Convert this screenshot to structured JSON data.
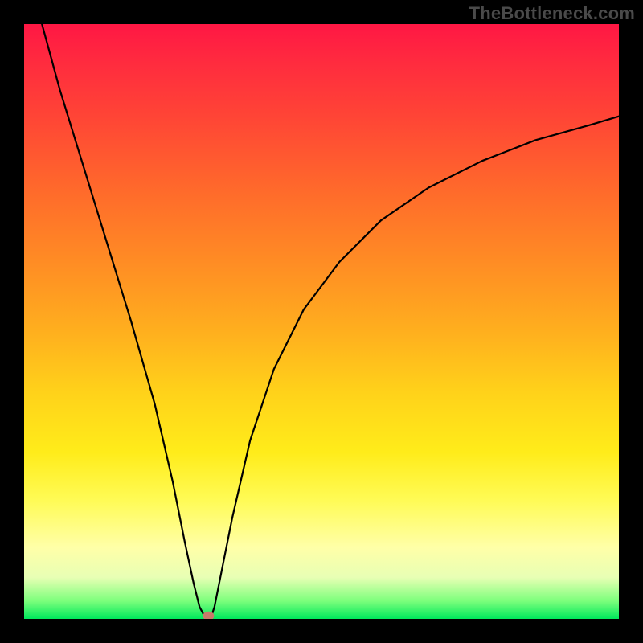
{
  "watermark": "TheBottleneck.com",
  "chart_data": {
    "type": "line",
    "title": "",
    "xlabel": "",
    "ylabel": "",
    "xlim": [
      0,
      100
    ],
    "ylim": [
      0,
      100
    ],
    "grid": false,
    "background": {
      "direction": "vertical",
      "stops": [
        {
          "pos": 0.0,
          "color": "#ff1744"
        },
        {
          "pos": 0.15,
          "color": "#ff4336"
        },
        {
          "pos": 0.4,
          "color": "#ff8c24"
        },
        {
          "pos": 0.62,
          "color": "#ffd21a"
        },
        {
          "pos": 0.8,
          "color": "#fffb55"
        },
        {
          "pos": 0.93,
          "color": "#e8ffb4"
        },
        {
          "pos": 1.0,
          "color": "#00e85c"
        }
      ]
    },
    "series": [
      {
        "name": "bottleneck-curve",
        "color": "#000000",
        "x": [
          3,
          6,
          10,
          14,
          18,
          22,
          25,
          27,
          28.5,
          29.5,
          30.3,
          31.5,
          32,
          33,
          35,
          38,
          42,
          47,
          53,
          60,
          68,
          77,
          86,
          95,
          100
        ],
        "y": [
          100,
          89,
          76,
          63,
          50,
          36,
          23,
          13,
          6,
          2,
          0.5,
          0.5,
          2,
          7,
          17,
          30,
          42,
          52,
          60,
          67,
          72.5,
          77,
          80.5,
          83,
          84.5
        ]
      }
    ],
    "markers": [
      {
        "name": "optimum-point",
        "x": 31,
        "y": 0.5,
        "color": "#c97a6a",
        "r": 6
      }
    ]
  }
}
